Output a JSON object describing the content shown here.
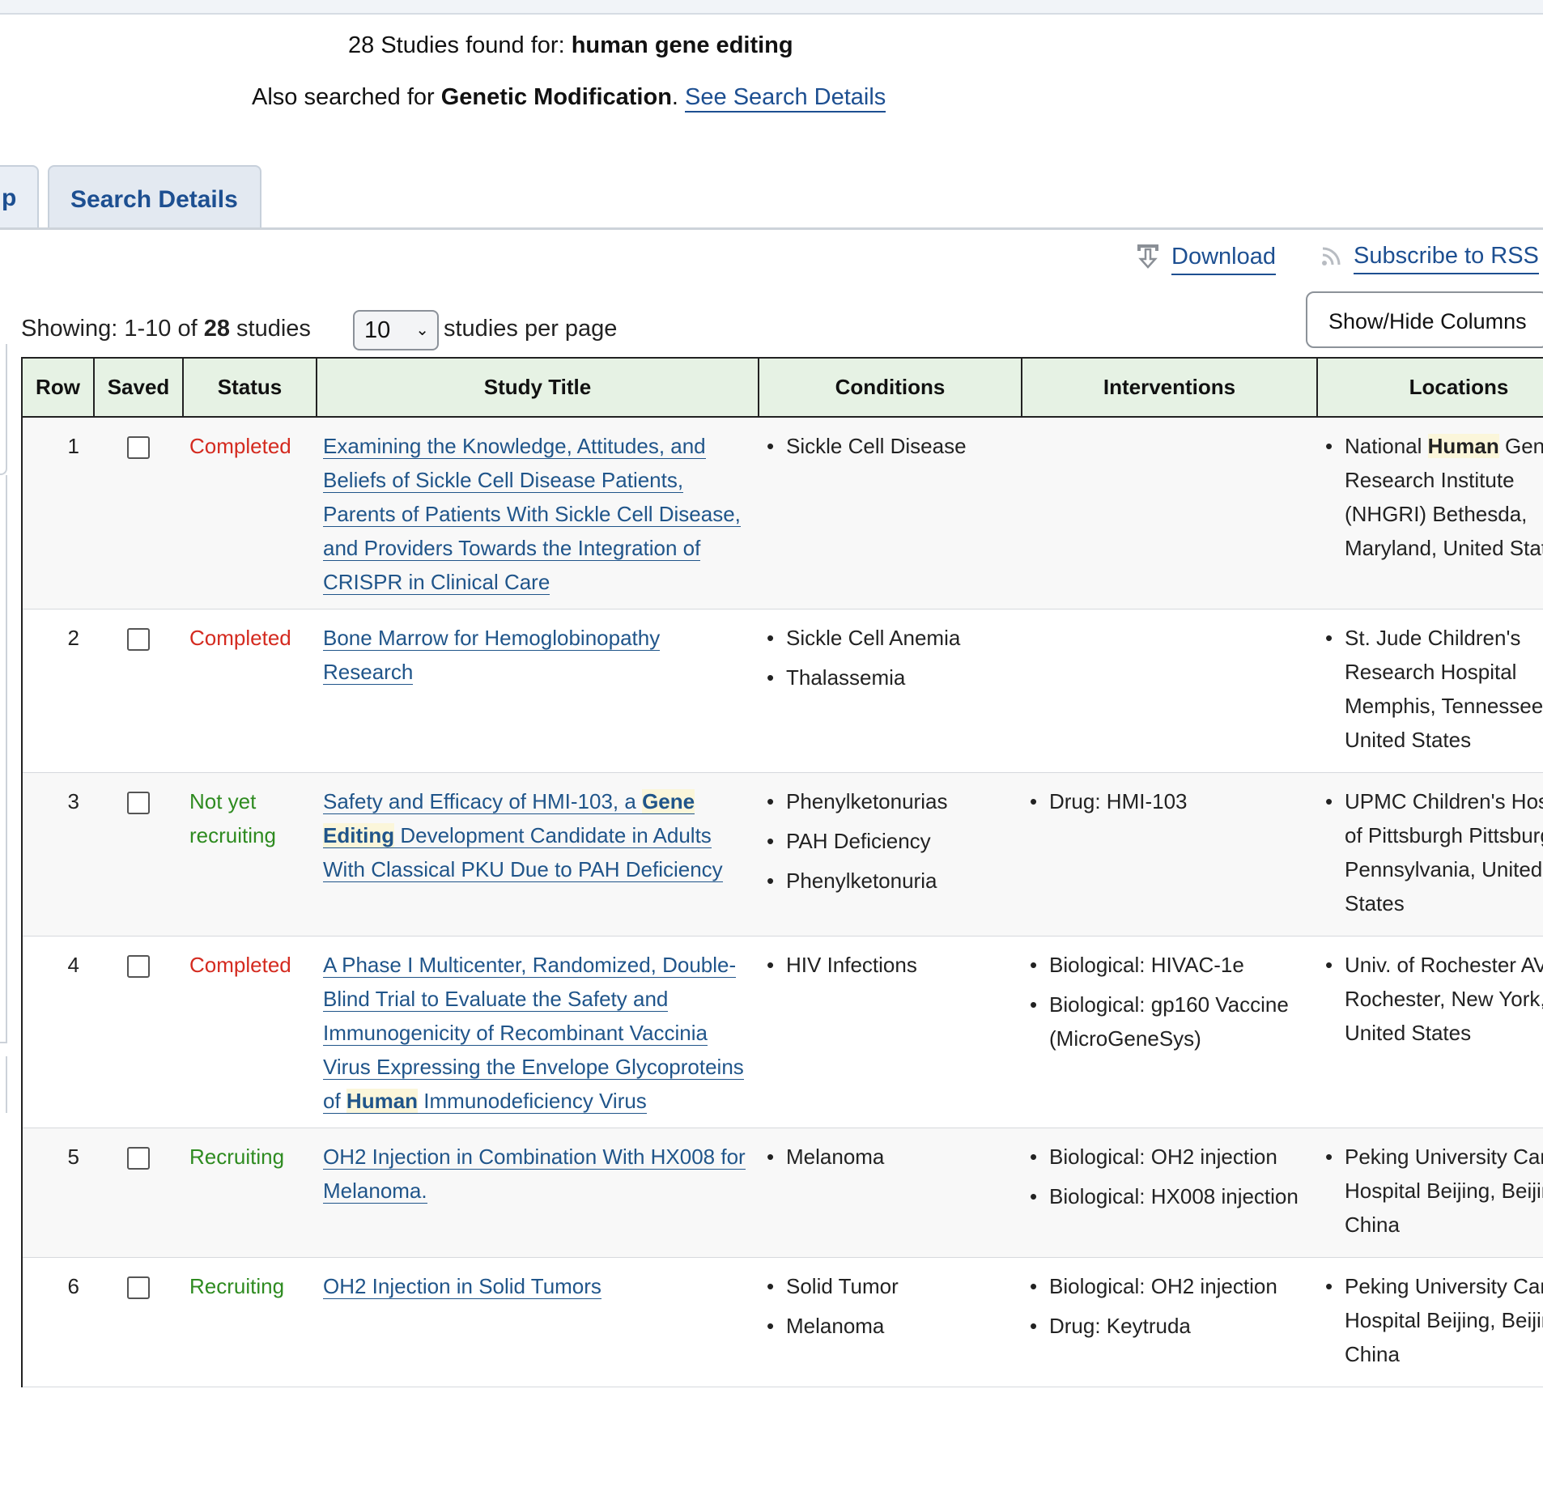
{
  "results": {
    "count_text": "28 Studies found for:",
    "query": "human gene editing",
    "also_prefix": "Also searched for",
    "also_term": "Genetic Modification",
    "also_suffix": ".",
    "details_link": "See Search Details"
  },
  "tabs": {
    "prev_partial": "p",
    "search_details": "Search Details"
  },
  "actions": {
    "download": "Download",
    "subscribe": "Subscribe to RSS"
  },
  "listing": {
    "showing_prefix": "Showing: 1-10 of",
    "total": "28",
    "showing_suffix": "studies",
    "per_page_value": "10",
    "per_page_label": "studies per page",
    "show_hide_columns": "Show/Hide Columns"
  },
  "table": {
    "headers": {
      "row": "Row",
      "saved": "Saved",
      "status": "Status",
      "title": "Study Title",
      "conditions": "Conditions",
      "interventions": "Interventions",
      "locations": "Locations"
    },
    "rows": [
      {
        "row": "1",
        "status": "Completed",
        "title_parts": [
          "Examining the Knowledge, Attitudes, and Beliefs of Sickle Cell Disease Patients, Parents of Patients With Sickle Cell Disease, and Providers Towards the Integration of CRISPR in Clinical Care"
        ],
        "conditions": [
          "Sickle Cell Disease"
        ],
        "interventions": [],
        "location_hl": "Human",
        "location_prefix": "National",
        "location_rest": "Genome Research Institute (NHGRI) Bethesda, Maryland, United States"
      },
      {
        "row": "2",
        "status": "Completed",
        "title_parts": [
          "Bone Marrow for Hemoglobinopathy Research"
        ],
        "conditions": [
          "Sickle Cell Anemia",
          "Thalassemia"
        ],
        "interventions": [],
        "location": "St. Jude Children's Research Hospital Memphis, Tennessee, United States"
      },
      {
        "row": "3",
        "status": "Not yet recruiting",
        "title_pre": "Safety and Efficacy of HMI-103, a",
        "title_hl": "Gene Editing",
        "title_post": "Development Candidate in Adults With Classical PKU Due to PAH Deficiency",
        "conditions": [
          "Phenylketonurias",
          "PAH Deficiency",
          "Phenylketonuria"
        ],
        "interventions": [
          "Drug: HMI-103"
        ],
        "location": "UPMC Children's Hospital of Pittsburgh Pittsburgh, Pennsylvania, United States"
      },
      {
        "row": "4",
        "status": "Completed",
        "title_pre": "A Phase I Multicenter, Randomized, Double-Blind Trial to Evaluate the Safety and Immunogenicity of Recombinant Vaccinia Virus Expressing the Envelope Glycoproteins of",
        "title_hl": "Human",
        "title_post": "Immunodeficiency Virus",
        "conditions": [
          "HIV Infections"
        ],
        "interventions": [
          "Biological: HIVAC-1e",
          "Biological: gp160 Vaccine (MicroGeneSys)"
        ],
        "location": "Univ. of Rochester AVEG Rochester, New York, United States"
      },
      {
        "row": "5",
        "status": "Recruiting",
        "title_parts": [
          "OH2 Injection in Combination With HX008 for Melanoma."
        ],
        "conditions": [
          "Melanoma"
        ],
        "interventions": [
          "Biological: OH2 injection",
          "Biological: HX008 injection"
        ],
        "location": "Peking University Cancer Hospital Beijing, Beijing, China"
      },
      {
        "row": "6",
        "status": "Recruiting",
        "title_parts": [
          "OH2 Injection in Solid Tumors"
        ],
        "conditions": [
          "Solid Tumor",
          "Melanoma"
        ],
        "interventions": [
          "Biological: OH2 injection",
          "Drug: Keytruda"
        ],
        "location": "Peking University Cancer Hospital Beijing, Beijing, China"
      }
    ]
  },
  "colors": {
    "completed": "#d42a1f",
    "recruiting": "#2e8b20",
    "link": "#20558a",
    "header_bg": "#e6f2e4"
  },
  "icons": {
    "download": "download-icon",
    "rss": "rss-icon",
    "select": "chevron-down-icon"
  }
}
